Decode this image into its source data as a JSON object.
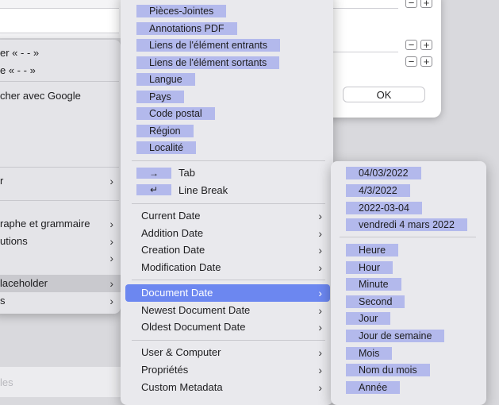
{
  "dialog": {
    "rows": [
      {
        "minus": "−",
        "plus": "+"
      },
      {
        "minus": "−",
        "plus": "+"
      },
      {
        "minus": "−",
        "plus": "+"
      }
    ],
    "ok_label": "OK"
  },
  "left_menu": {
    "items": [
      {
        "label": "er « - - »",
        "chevron": ""
      },
      {
        "label": "e « - - »",
        "chevron": ""
      },
      {
        "label": "cher avec Google",
        "chevron": ""
      },
      {
        "label": "r",
        "chevron": "›"
      },
      {
        "label": "raphe et grammaire",
        "chevron": "›"
      },
      {
        "label": "utions",
        "chevron": "›"
      },
      {
        "label": "",
        "chevron": "›"
      },
      {
        "label": "laceholder",
        "chevron": "›"
      },
      {
        "label": "s",
        "chevron": "›"
      }
    ],
    "footer_text": "les"
  },
  "middle_menu": {
    "tags": [
      "Pièces-Jointes",
      "Annotations PDF",
      "Liens de l'élément entrants",
      "Liens de l'élément sortants",
      "Langue",
      "Pays",
      "Code postal",
      "Région",
      "Localité"
    ],
    "keys": [
      {
        "symbol": "→",
        "label": "Tab"
      },
      {
        "symbol": "↵",
        "label": "Line Break"
      }
    ],
    "date_items": [
      {
        "label": "Current Date",
        "chevron": "›"
      },
      {
        "label": "Addition Date",
        "chevron": "›"
      },
      {
        "label": "Creation Date",
        "chevron": "›"
      },
      {
        "label": "Modification Date",
        "chevron": "›"
      }
    ],
    "doc_items": [
      {
        "label": "Document Date",
        "chevron": "›"
      },
      {
        "label": "Newest Document Date",
        "chevron": "›"
      },
      {
        "label": "Oldest Document Date",
        "chevron": "›"
      }
    ],
    "other_items": [
      {
        "label": "User & Computer",
        "chevron": "›"
      },
      {
        "label": "Propriétés",
        "chevron": "›"
      },
      {
        "label": "Custom Metadata",
        "chevron": "›"
      }
    ]
  },
  "right_menu": {
    "date_formats": [
      "04/03/2022",
      "4/3/2022",
      "2022-03-04",
      "vendredi 4 mars 2022"
    ],
    "components": [
      "Heure",
      "Hour",
      "Minute",
      "Second",
      "Jour",
      "Jour de semaine",
      "Mois",
      "Nom du mois",
      "Année"
    ]
  }
}
